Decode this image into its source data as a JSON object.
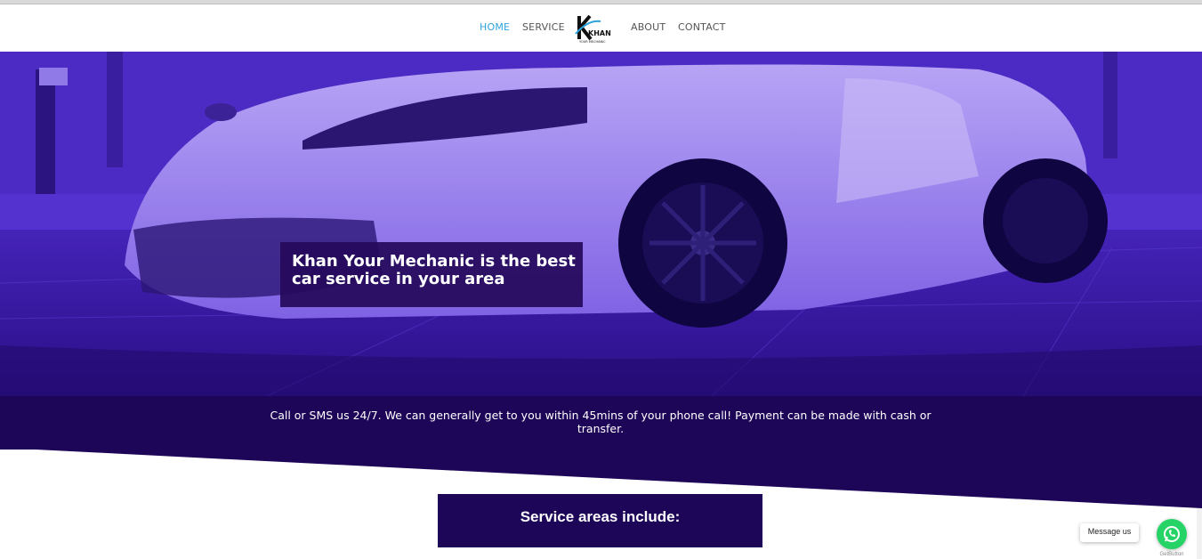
{
  "nav": {
    "items": [
      {
        "label": "HOME",
        "active": true
      },
      {
        "label": "SERVICE",
        "active": false
      },
      {
        "label": "ABOUT",
        "active": false
      },
      {
        "label": "CONTACT",
        "active": false
      }
    ],
    "logo": {
      "text": "KHAN",
      "subtext": "YOUR MECHANIC",
      "icon": "khan-logo"
    }
  },
  "hero": {
    "headline": "Khan Your Mechanic is the best car service in your area",
    "overlay_color": "#4a25c4"
  },
  "band": {
    "text": "Call or SMS us 24/7. We can generally get to you within 45mins of your phone call! Payment can be made with cash or transfer.",
    "color": "#1d0557"
  },
  "service_areas": {
    "title": "Service areas include:"
  },
  "widget": {
    "message_label": "Message us",
    "brand": "GetButton",
    "icon": "whatsapp-icon",
    "color": "#25d366"
  }
}
